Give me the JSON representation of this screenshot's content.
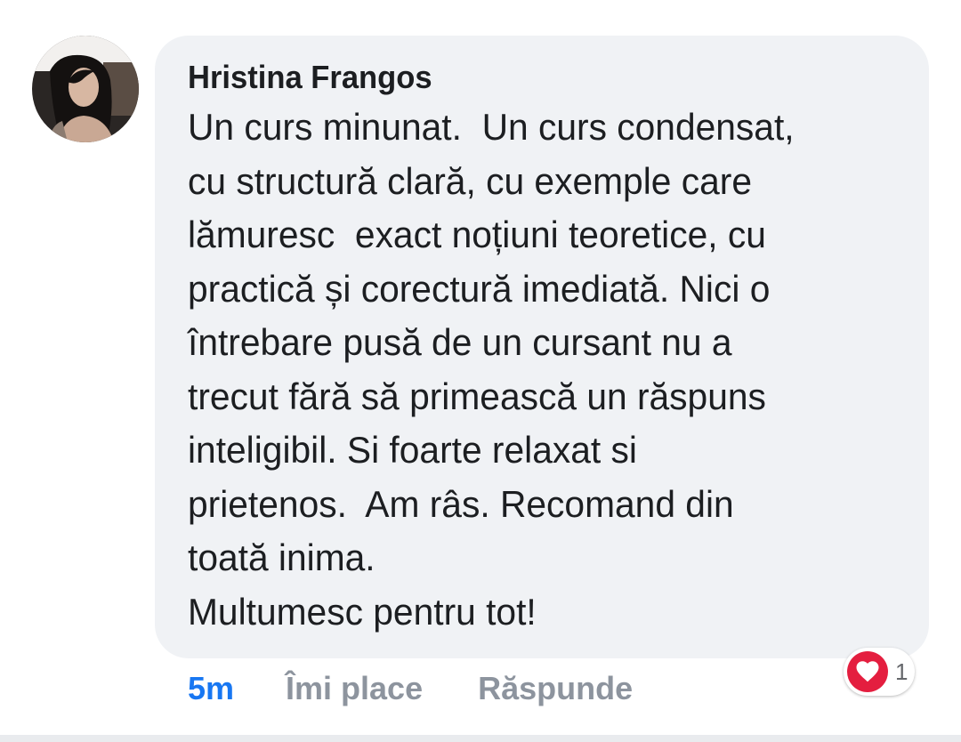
{
  "comment": {
    "author_name": "Hristina Frangos",
    "body_lines": [
      "Un curs minunat.  Un curs condensat,",
      "cu structură clară, cu exemple care",
      "lămuresc  exact noțiuni teoretice, cu",
      "practică și corectură imediată. Nici o",
      "întrebare pusă de un cursant nu a",
      "trecut fără să primească un răspuns",
      "inteligibil. Si foarte relaxat si",
      "prietenos.  Am râs. Recomand din",
      "toată inima.",
      "Multumesc pentru tot!"
    ],
    "time": "5m",
    "like_label": "Îmi place",
    "reply_label": "Răspunde",
    "reactions": {
      "icon": "heart-icon",
      "count": "1"
    }
  },
  "colors": {
    "bubble": "#f0f2f5",
    "text": "#1c1e21",
    "time": "#1877f2",
    "action": "#8d949e",
    "heart": "#e41e3f"
  }
}
